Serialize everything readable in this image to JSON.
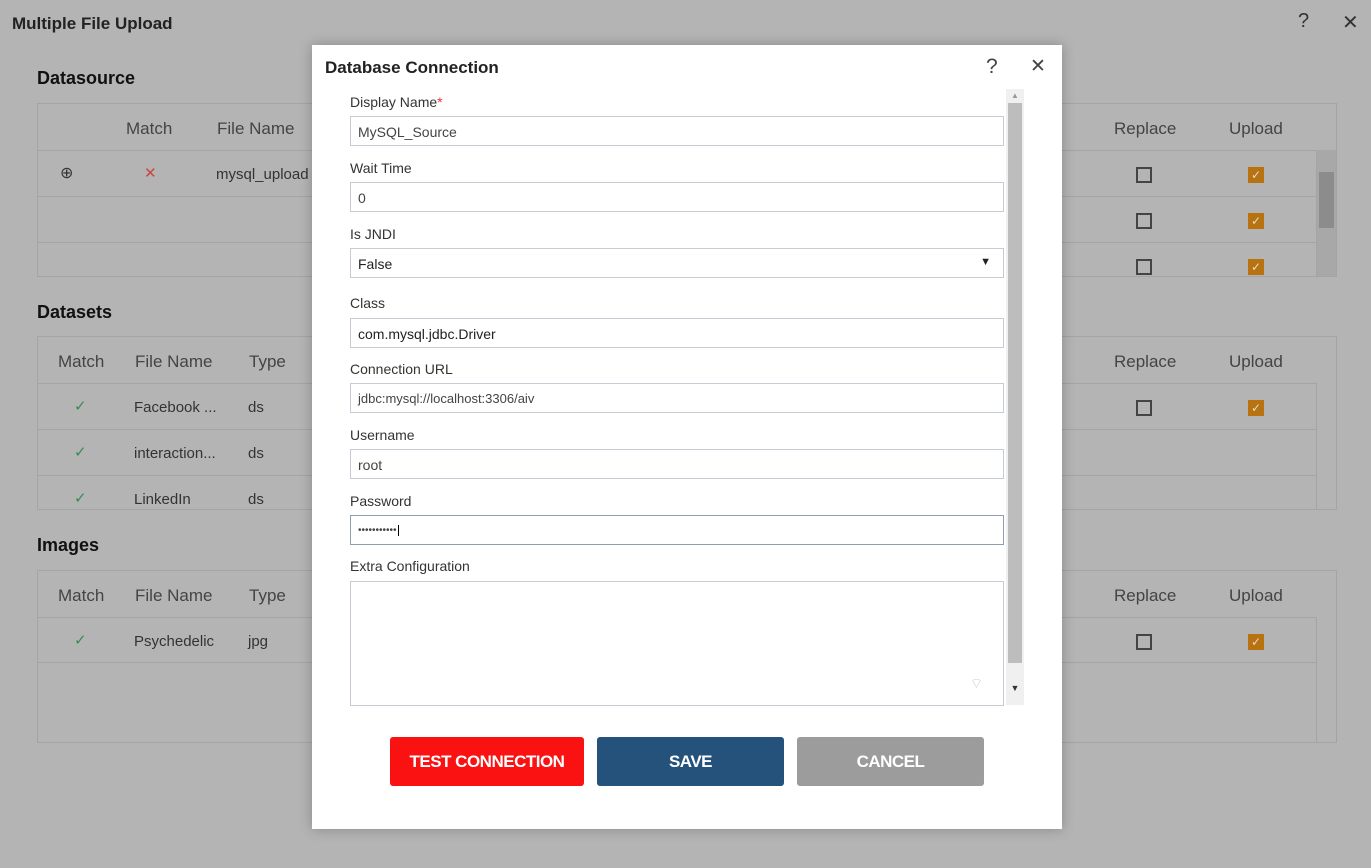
{
  "app": {
    "title": "Multiple File Upload",
    "help": "?",
    "close": "✕"
  },
  "datasource": {
    "title": "Datasource",
    "headers": [
      "Match",
      "File Name",
      "Replace",
      "Upload"
    ],
    "rows": [
      {
        "match": "✕",
        "file": "mysql_upload",
        "replace": false,
        "upload": true
      },
      {
        "replace": false,
        "upload": true
      },
      {
        "replace": false,
        "upload": true
      }
    ]
  },
  "datasets": {
    "title": "Datasets",
    "headers": [
      "Match",
      "File Name",
      "Type",
      "Replace",
      "Upload"
    ],
    "rows": [
      {
        "match": "✓",
        "file": "Facebook ...",
        "type": "ds",
        "replace": false,
        "upload": true
      },
      {
        "match": "✓",
        "file": "interaction...",
        "type": "ds"
      },
      {
        "match": "✓",
        "file": "LinkedIn",
        "type": "ds"
      }
    ]
  },
  "images": {
    "title": "Images",
    "headers": [
      "Match",
      "File Name",
      "Type",
      "Replace",
      "Upload"
    ],
    "rows": [
      {
        "match": "✓",
        "file": "Psychedelic",
        "type": "jpg",
        "replace": false,
        "upload": true
      }
    ]
  },
  "modal": {
    "title": "Database Connection",
    "help": "?",
    "close": "✕",
    "fields": {
      "display_name": {
        "label": "Display Name",
        "required": "*",
        "value": "MySQL_Source"
      },
      "wait_time": {
        "label": "Wait Time",
        "value": "0"
      },
      "is_jndi": {
        "label": "Is JNDI",
        "value": "False"
      },
      "class": {
        "label": "Class",
        "value": "com.mysql.jdbc.Driver"
      },
      "url": {
        "label": "Connection URL",
        "value": "jdbc:mysql://localhost:3306/aiv"
      },
      "username": {
        "label": "Username",
        "value": "root"
      },
      "password": {
        "label": "Password",
        "value": "•••••••••••"
      },
      "extra": {
        "label": "Extra Configuration",
        "value": ""
      }
    },
    "buttons": {
      "test": "TEST CONNECTION",
      "save": "SAVE",
      "cancel": "CANCEL"
    },
    "colors": {
      "test": "#fa1111",
      "save": "#24527a",
      "cancel": "#9c9c9c"
    }
  }
}
